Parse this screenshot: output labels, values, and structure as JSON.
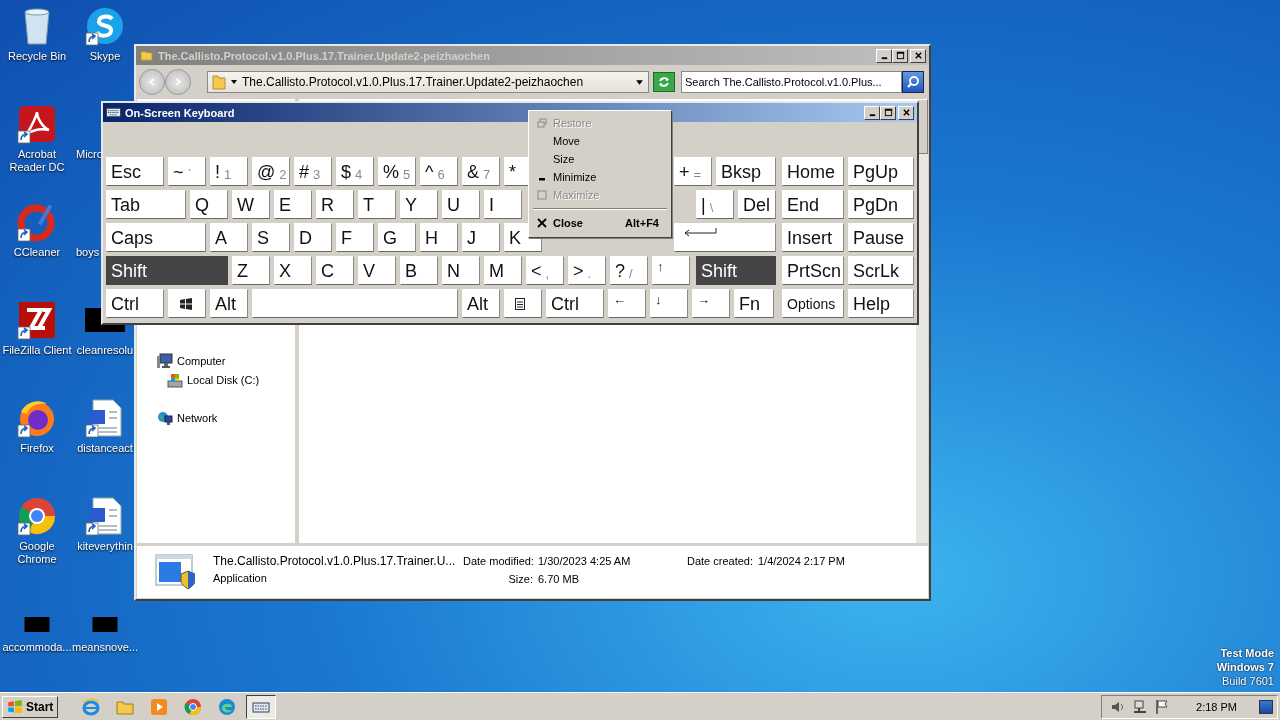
{
  "desktop": {
    "icons": [
      {
        "label": "Recycle Bin",
        "kind": "recycle",
        "shortcut": false
      },
      {
        "label": "Acrobat Reader DC",
        "kind": "acrobat",
        "shortcut": true
      },
      {
        "label": "CCleaner",
        "kind": "ccleaner",
        "shortcut": true
      },
      {
        "label": "FileZilla Client",
        "kind": "filezilla",
        "shortcut": true
      },
      {
        "label": "Firefox",
        "kind": "firefox",
        "shortcut": true
      },
      {
        "label": "Google Chrome",
        "kind": "chrome",
        "shortcut": true
      },
      {
        "label": "accommoda...",
        "kind": "blank",
        "shortcut": false
      },
      {
        "label": "Skype",
        "kind": "skype",
        "shortcut": true
      },
      {
        "label": "Micro",
        "kind": "covered"
      },
      {
        "label": "boys",
        "kind": "covered"
      },
      {
        "label": "cleanresolu",
        "kind": "blank",
        "shortcut": false
      },
      {
        "label": "distanceact",
        "kind": "worddoc",
        "shortcut": true
      },
      {
        "label": "kiteverythin",
        "kind": "worddoc",
        "shortcut": true
      },
      {
        "label": "meansnove...",
        "kind": "blank",
        "shortcut": false
      }
    ],
    "os_notice": [
      "Test Mode",
      "Windows 7",
      "Build 7601"
    ]
  },
  "explorer": {
    "title": "The.Callisto.Protocol.v1.0.Plus.17.Trainer.Update2-peizhaochen",
    "active": false,
    "address": "The.Callisto.Protocol.v1.0.Plus.17.Trainer.Update2-peizhaochen",
    "search_placeholder": "Search The.Callisto.Protocol.v1.0.Plus...",
    "nav": [
      {
        "label": "Computer",
        "kind": "computer",
        "children": [
          {
            "label": "Local Disk (C:)",
            "kind": "drive"
          }
        ]
      },
      {
        "label": "Network",
        "kind": "network"
      }
    ],
    "details": {
      "name": "The.Callisto.Protocol.v1.0.Plus.17.Trainer.U...",
      "type": "Application",
      "fields": [
        {
          "label": "Date modified:",
          "value": "1/30/2023 4:25 AM"
        },
        {
          "label": "Size:",
          "value": "6.70 MB"
        },
        {
          "label": "Date created:",
          "value": "1/4/2024 2:17 PM"
        }
      ]
    }
  },
  "keyboard": {
    "title": "On-Screen Keyboard",
    "active": true,
    "rows": [
      {
        "start": [
          {
            "main": "Esc",
            "kind": "esc",
            "pressed": false
          },
          {
            "main": "~",
            "sub": "`",
            "kind": "key",
            "pressed": false
          },
          {
            "main": "!",
            "sub": "1",
            "kind": "key",
            "pressed": false
          },
          {
            "main": "@",
            "sub": "2",
            "kind": "key",
            "pressed": false
          },
          {
            "main": "#",
            "sub": "3",
            "kind": "key",
            "pressed": false
          },
          {
            "main": "$",
            "sub": "4",
            "kind": "key",
            "pressed": false
          },
          {
            "main": "%",
            "sub": "5",
            "kind": "key",
            "pressed": false
          },
          {
            "main": "^",
            "sub": "6",
            "kind": "key",
            "pressed": false
          },
          {
            "main": "&",
            "sub": "7",
            "kind": "key",
            "pressed": false
          },
          {
            "main": "*",
            "kind": "key",
            "pressed": false
          }
        ],
        "end": [
          {
            "main": "+",
            "sub": "=",
            "kind": "key",
            "pressed": false
          },
          {
            "main": "Bksp",
            "kind": "bksp",
            "pressed": false
          }
        ]
      },
      {
        "start": [
          {
            "main": "Tab",
            "kind": "tab",
            "pressed": false
          },
          {
            "main": "Q",
            "kind": "key",
            "pressed": false
          },
          {
            "main": "W",
            "kind": "key",
            "pressed": false
          },
          {
            "main": "E",
            "kind": "key",
            "pressed": false
          },
          {
            "main": "R",
            "kind": "key",
            "pressed": false
          },
          {
            "main": "T",
            "kind": "key",
            "pressed": false
          },
          {
            "main": "Y",
            "kind": "key",
            "pressed": false
          },
          {
            "main": "U",
            "kind": "key",
            "pressed": false
          },
          {
            "main": "I",
            "kind": "key",
            "pressed": false
          }
        ],
        "end": [
          {
            "main": "|",
            "sub": "\\",
            "kind": "key",
            "pressed": false
          },
          {
            "main": "Del",
            "kind": "key",
            "pressed": false
          }
        ]
      },
      {
        "start": [
          {
            "main": "Caps",
            "kind": "caps",
            "pressed": false
          },
          {
            "main": "A",
            "kind": "key",
            "pressed": false
          },
          {
            "main": "S",
            "kind": "key",
            "pressed": false
          },
          {
            "main": "D",
            "kind": "key",
            "pressed": false
          },
          {
            "main": "F",
            "kind": "key",
            "pressed": false
          },
          {
            "main": "G",
            "kind": "key",
            "pressed": false
          },
          {
            "main": "H",
            "kind": "key",
            "pressed": false
          },
          {
            "main": "J",
            "kind": "key",
            "pressed": false
          },
          {
            "main": "K",
            "kind": "key",
            "pressed": false
          }
        ],
        "end": [
          {
            "kind": "enter",
            "pressed": false
          }
        ]
      },
      {
        "start": [
          {
            "main": "Shift",
            "kind": "shift",
            "pressed": true
          },
          {
            "main": "Z",
            "kind": "key",
            "pressed": false
          },
          {
            "main": "X",
            "kind": "key",
            "pressed": false
          },
          {
            "main": "C",
            "kind": "key",
            "pressed": false
          },
          {
            "main": "V",
            "kind": "key",
            "pressed": false
          },
          {
            "main": "B",
            "kind": "key",
            "pressed": false
          },
          {
            "main": "N",
            "kind": "key",
            "pressed": false
          },
          {
            "main": "M",
            "kind": "key",
            "pressed": false
          },
          {
            "main": "<",
            "sub": ",",
            "kind": "key",
            "pressed": false
          },
          {
            "main": ">",
            "sub": ".",
            "kind": "key",
            "pressed": false
          },
          {
            "main": "?",
            "sub": "/",
            "kind": "key",
            "pressed": false
          },
          {
            "main": "↑",
            "kind": "arrow",
            "pressed": false
          }
        ],
        "end": [
          {
            "main": "Shift",
            "kind": "rshift",
            "pressed": true
          }
        ]
      },
      {
        "start": [
          {
            "main": "Ctrl",
            "kind": "ctrl",
            "pressed": false
          },
          {
            "kind": "win",
            "pressed": false
          },
          {
            "main": "Alt",
            "kind": "key",
            "pressed": false
          },
          {
            "kind": "space",
            "pressed": false
          },
          {
            "main": "Alt",
            "kind": "key",
            "pressed": false
          },
          {
            "kind": "menu",
            "pressed": false
          },
          {
            "main": "Ctrl",
            "kind": "ctrl",
            "pressed": false
          },
          {
            "main": "←",
            "kind": "arrow",
            "pressed": false
          },
          {
            "main": "↓",
            "kind": "arrow",
            "pressed": false
          },
          {
            "main": "→",
            "kind": "arrow",
            "pressed": false
          },
          {
            "main": "Fn",
            "kind": "fn",
            "pressed": false
          }
        ],
        "end": []
      }
    ],
    "nav_rows": [
      [
        {
          "main": "Home",
          "kind": "nav",
          "pressed": false
        },
        {
          "main": "PgUp",
          "kind": "nav2",
          "pressed": false
        }
      ],
      [
        {
          "main": "End",
          "kind": "nav",
          "pressed": false
        },
        {
          "main": "PgDn",
          "kind": "nav2",
          "pressed": false
        }
      ],
      [
        {
          "main": "Insert",
          "kind": "nav",
          "pressed": false
        },
        {
          "main": "Pause",
          "kind": "nav2",
          "pressed": false
        }
      ],
      [
        {
          "main": "PrtScn",
          "kind": "nav",
          "pressed": false
        },
        {
          "main": "ScrLk",
          "kind": "nav2",
          "pressed": false
        }
      ],
      [
        {
          "main": "Options",
          "kind": "small",
          "pressed": false
        },
        {
          "main": "Help",
          "kind": "nav2",
          "pressed": false
        }
      ]
    ]
  },
  "system_menu": {
    "items": [
      {
        "label": "Restore",
        "disabled": true,
        "default": false
      },
      {
        "label": "Move",
        "disabled": false,
        "default": false
      },
      {
        "label": "Size",
        "disabled": false,
        "default": false
      },
      {
        "label": "Minimize",
        "disabled": false,
        "default": false
      },
      {
        "label": "Maximize",
        "disabled": true,
        "default": false
      },
      {
        "label": "Close",
        "disabled": false,
        "default": true,
        "shortcut": "Alt+F4"
      }
    ]
  },
  "taskbar": {
    "start": "Start",
    "apps": [
      {
        "kind": "ie",
        "selected": false
      },
      {
        "kind": "folder",
        "selected": false
      },
      {
        "kind": "media",
        "selected": false
      },
      {
        "kind": "chrome",
        "selected": false
      },
      {
        "kind": "edge",
        "selected": false
      },
      {
        "kind": "keyboard",
        "selected": true
      }
    ],
    "clock": "2:18 PM"
  }
}
